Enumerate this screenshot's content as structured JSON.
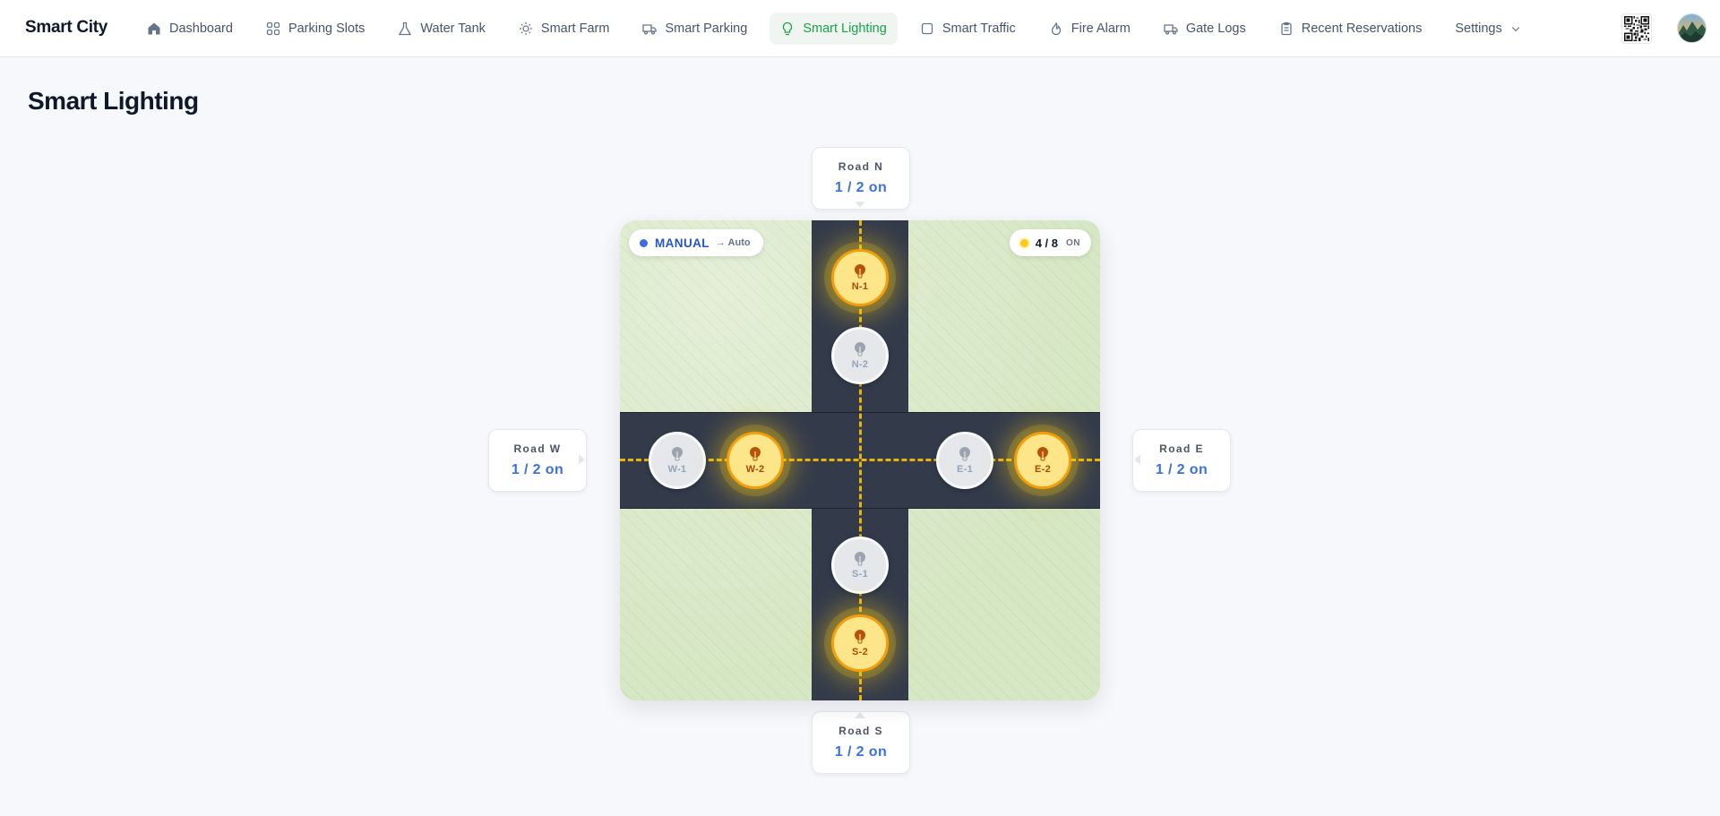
{
  "app": {
    "brand": "Smart City"
  },
  "nav": [
    {
      "label": "Dashboard",
      "icon": "home-icon"
    },
    {
      "label": "Parking Slots",
      "icon": "grid-icon"
    },
    {
      "label": "Water Tank",
      "icon": "flask-icon"
    },
    {
      "label": "Smart Farm",
      "icon": "sun-icon"
    },
    {
      "label": "Smart Parking",
      "icon": "truck-icon"
    },
    {
      "label": "Smart Lighting",
      "icon": "bulb-icon",
      "active": true
    },
    {
      "label": "Smart Traffic",
      "icon": "square-icon"
    },
    {
      "label": "Fire Alarm",
      "icon": "flame-icon"
    },
    {
      "label": "Gate Logs",
      "icon": "truck-icon"
    },
    {
      "label": "Recent Reservations",
      "icon": "clipboard-icon"
    },
    {
      "label": "Settings",
      "icon": "chevron-down-icon"
    }
  ],
  "page": {
    "title": "Smart Lighting"
  },
  "map": {
    "mode": "MANUAL",
    "mode_switch": "→ Auto",
    "lights_on": "4 / 8",
    "lights_on_suffix": "ON",
    "lamps": {
      "n1": {
        "label": "N-1",
        "state": "on"
      },
      "n2": {
        "label": "N-2",
        "state": "off"
      },
      "w1": {
        "label": "W-1",
        "state": "off"
      },
      "w2": {
        "label": "W-2",
        "state": "on"
      },
      "e1": {
        "label": "E-1",
        "state": "off"
      },
      "e2": {
        "label": "E-2",
        "state": "on"
      },
      "s1": {
        "label": "S-1",
        "state": "off"
      },
      "s2": {
        "label": "S-2",
        "state": "on"
      }
    }
  },
  "roads": {
    "n": {
      "name": "Road N",
      "value": "1 / 2 on"
    },
    "w": {
      "name": "Road W",
      "value": "1 / 2 on"
    },
    "e": {
      "name": "Road E",
      "value": "1 / 2 on"
    },
    "s": {
      "name": "Road S",
      "value": "1 / 2 on"
    }
  },
  "colors": {
    "accent": "#16a34a",
    "mode_blue": "#2456c7",
    "road": "#333b4b",
    "lamp_on": "#f59e0b",
    "lane": "#eab308"
  }
}
